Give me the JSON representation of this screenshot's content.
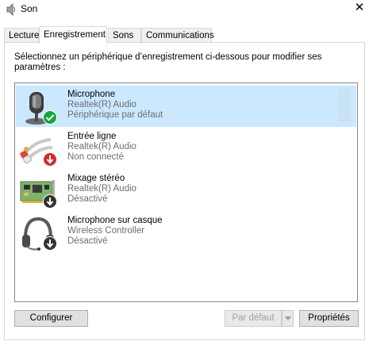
{
  "window": {
    "title": "Son",
    "close_glyph": "✕",
    "icon": "speaker-icon"
  },
  "tabs": [
    {
      "label": "Lecture",
      "active": false
    },
    {
      "label": "Enregistrement",
      "active": true
    },
    {
      "label": "Sons",
      "active": false
    },
    {
      "label": "Communications",
      "active": false
    }
  ],
  "panel": {
    "instruction": "Sélectionnez un périphérique d’enregistrement ci-dessous pour modifier ses paramètres :"
  },
  "devices": [
    {
      "name": "Microphone",
      "driver": "Realtek(R) Audio",
      "status": "Périphérique par défaut",
      "icon": "microphone-icon",
      "badge": "default-check-badge",
      "selected": true
    },
    {
      "name": "Entrée ligne",
      "driver": "Realtek(R) Audio",
      "status": "Non connecté",
      "icon": "line-in-cable-icon",
      "badge": "not-connected-badge",
      "selected": false
    },
    {
      "name": "Mixage stéréo",
      "driver": "Realtek(R) Audio",
      "status": "Désactivé",
      "icon": "sound-card-icon",
      "badge": "disabled-badge",
      "selected": false
    },
    {
      "name": "Microphone sur casque",
      "driver": "Wireless Controller",
      "status": "Désactivé",
      "icon": "headset-icon",
      "badge": "disabled-badge",
      "selected": false
    }
  ],
  "buttons": {
    "configure": "Configurer",
    "set_default": "Par défaut",
    "properties": "Propriétés"
  },
  "colors": {
    "selection": "#cce8ff",
    "check_badge": "#12a83a",
    "not_connected_badge": "#d22b2b",
    "disabled_badge": "#333333"
  }
}
